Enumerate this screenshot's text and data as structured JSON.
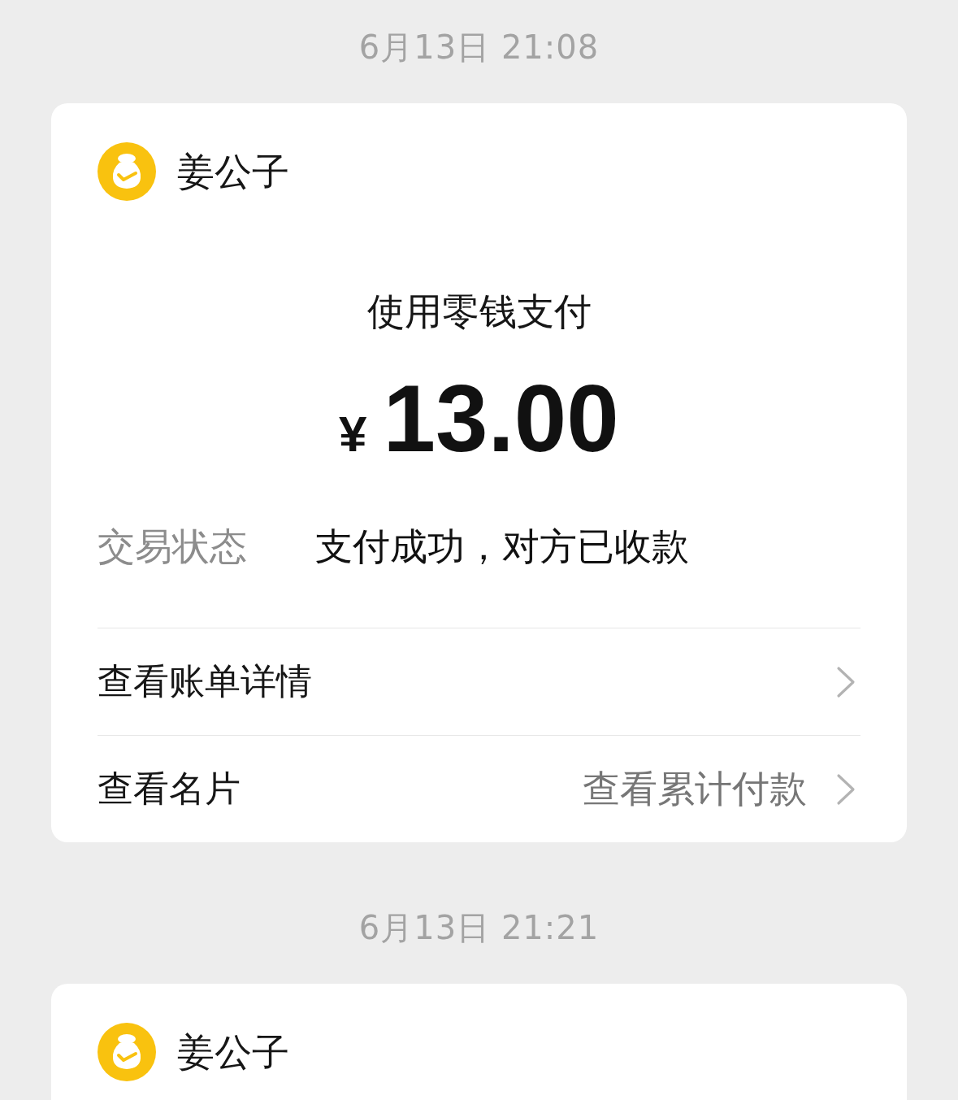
{
  "messages": [
    {
      "timestamp": "6月13日 21:08",
      "card": {
        "merchant": "姜公子",
        "title": "使用零钱支付",
        "currency": "¥",
        "amount": "13.00",
        "status": {
          "label": "交易状态",
          "value": "支付成功，对方已收款"
        },
        "links": [
          {
            "label": "查看账单详情"
          },
          {
            "label": "查看名片",
            "value": "查看累计付款"
          }
        ]
      }
    },
    {
      "timestamp": "6月13日 21:21",
      "card": {
        "merchant": "姜公子"
      }
    }
  ]
}
